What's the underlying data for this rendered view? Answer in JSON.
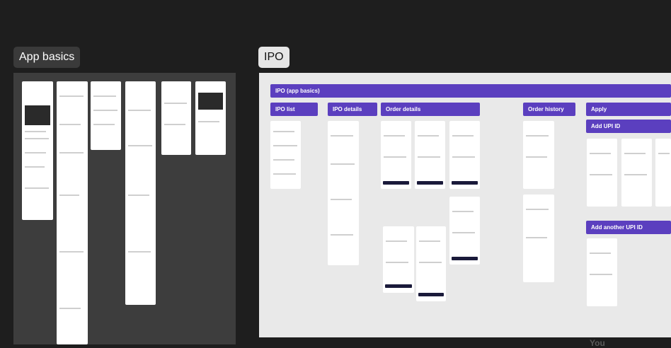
{
  "canvas": {
    "background": "#1e1e1e",
    "accent": "#5b3fbf"
  },
  "sections": {
    "app_basics": {
      "label": "App basics"
    },
    "ipo": {
      "label": "IPO",
      "header": "IPO (app basics)",
      "columns": [
        "IPO list",
        "IPO details",
        "Order details",
        "Order history",
        "Apply"
      ],
      "sub_headers": [
        "Add UPI ID",
        "Add another UPI ID"
      ]
    }
  },
  "cursor_label": "You"
}
